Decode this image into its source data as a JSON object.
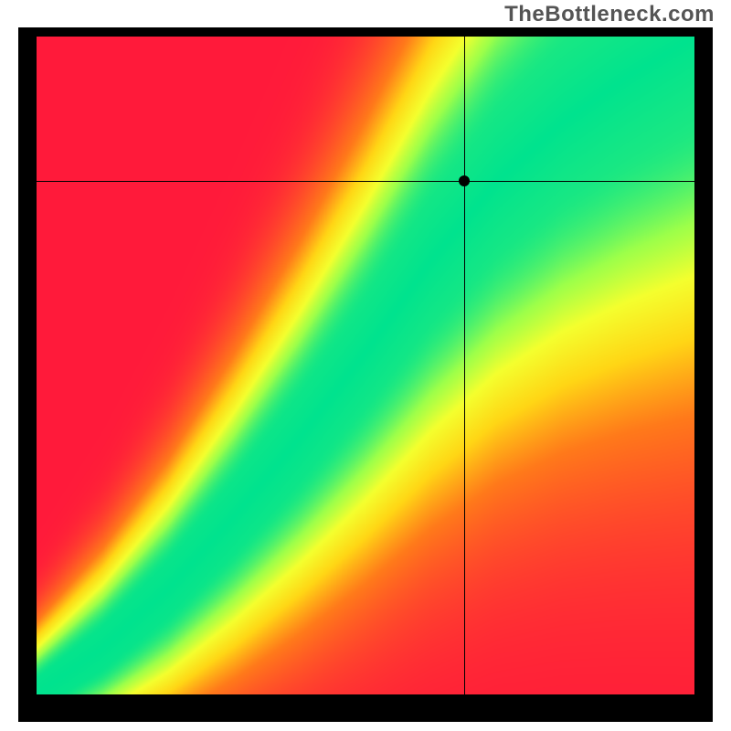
{
  "watermark": "TheBottleneck.com",
  "chart_data": {
    "type": "heatmap",
    "title": "",
    "xlabel": "",
    "ylabel": "",
    "xlim": [
      0,
      1
    ],
    "ylim": [
      0,
      1
    ],
    "crosshair": {
      "x": 0.65,
      "y": 0.78
    },
    "marker": {
      "x": 0.65,
      "y": 0.78
    },
    "colormap": {
      "description": "Value 0 = red, 0.5 = yellow, 1 = green; diagonal ridge from bottom-left to top-right is optimal (green)",
      "stops": [
        {
          "t": 0.0,
          "color": "#ff1a3a"
        },
        {
          "t": 0.35,
          "color": "#ff7a1a"
        },
        {
          "t": 0.55,
          "color": "#ffd615"
        },
        {
          "t": 0.72,
          "color": "#f4ff2e"
        },
        {
          "t": 0.85,
          "color": "#9cff4a"
        },
        {
          "t": 1.0,
          "color": "#00e38e"
        }
      ]
    },
    "ridge": {
      "description": "Center of the green optimal band as y(x) control points, 0..1 normalized",
      "points": [
        {
          "x": 0.0,
          "y": 0.0
        },
        {
          "x": 0.1,
          "y": 0.07
        },
        {
          "x": 0.2,
          "y": 0.16
        },
        {
          "x": 0.3,
          "y": 0.27
        },
        {
          "x": 0.4,
          "y": 0.39
        },
        {
          "x": 0.5,
          "y": 0.52
        },
        {
          "x": 0.6,
          "y": 0.66
        },
        {
          "x": 0.7,
          "y": 0.78
        },
        {
          "x": 0.8,
          "y": 0.87
        },
        {
          "x": 0.9,
          "y": 0.94
        },
        {
          "x": 1.0,
          "y": 1.0
        }
      ],
      "base_half_width": 0.02,
      "width_growth": 0.11
    }
  }
}
